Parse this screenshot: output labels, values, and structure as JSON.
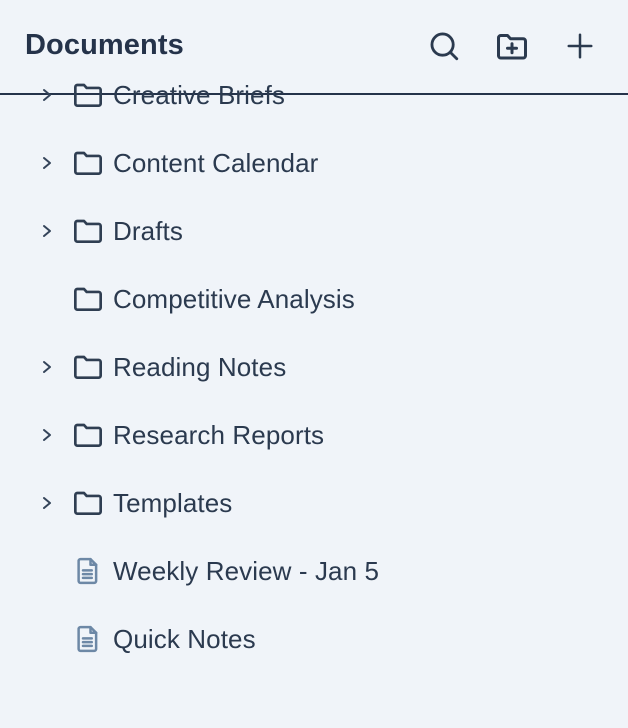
{
  "header": {
    "title": "Documents",
    "actions": [
      {
        "name": "search-button",
        "icon": "search-icon"
      },
      {
        "name": "new-folder-button",
        "icon": "folder-plus-icon"
      },
      {
        "name": "add-button",
        "icon": "plus-icon"
      }
    ]
  },
  "items": [
    {
      "label": "Creative Briefs",
      "type": "folder",
      "expandable": true
    },
    {
      "label": "Content Calendar",
      "type": "folder",
      "expandable": true
    },
    {
      "label": "Drafts",
      "type": "folder",
      "expandable": true
    },
    {
      "label": "Competitive Analysis",
      "type": "folder",
      "expandable": false
    },
    {
      "label": "Reading Notes",
      "type": "folder",
      "expandable": true
    },
    {
      "label": "Research Reports",
      "type": "folder",
      "expandable": true
    },
    {
      "label": "Templates",
      "type": "folder",
      "expandable": true
    },
    {
      "label": "Weekly Review - Jan 5",
      "type": "file",
      "expandable": false
    },
    {
      "label": "Quick Notes",
      "type": "file",
      "expandable": false
    }
  ]
}
